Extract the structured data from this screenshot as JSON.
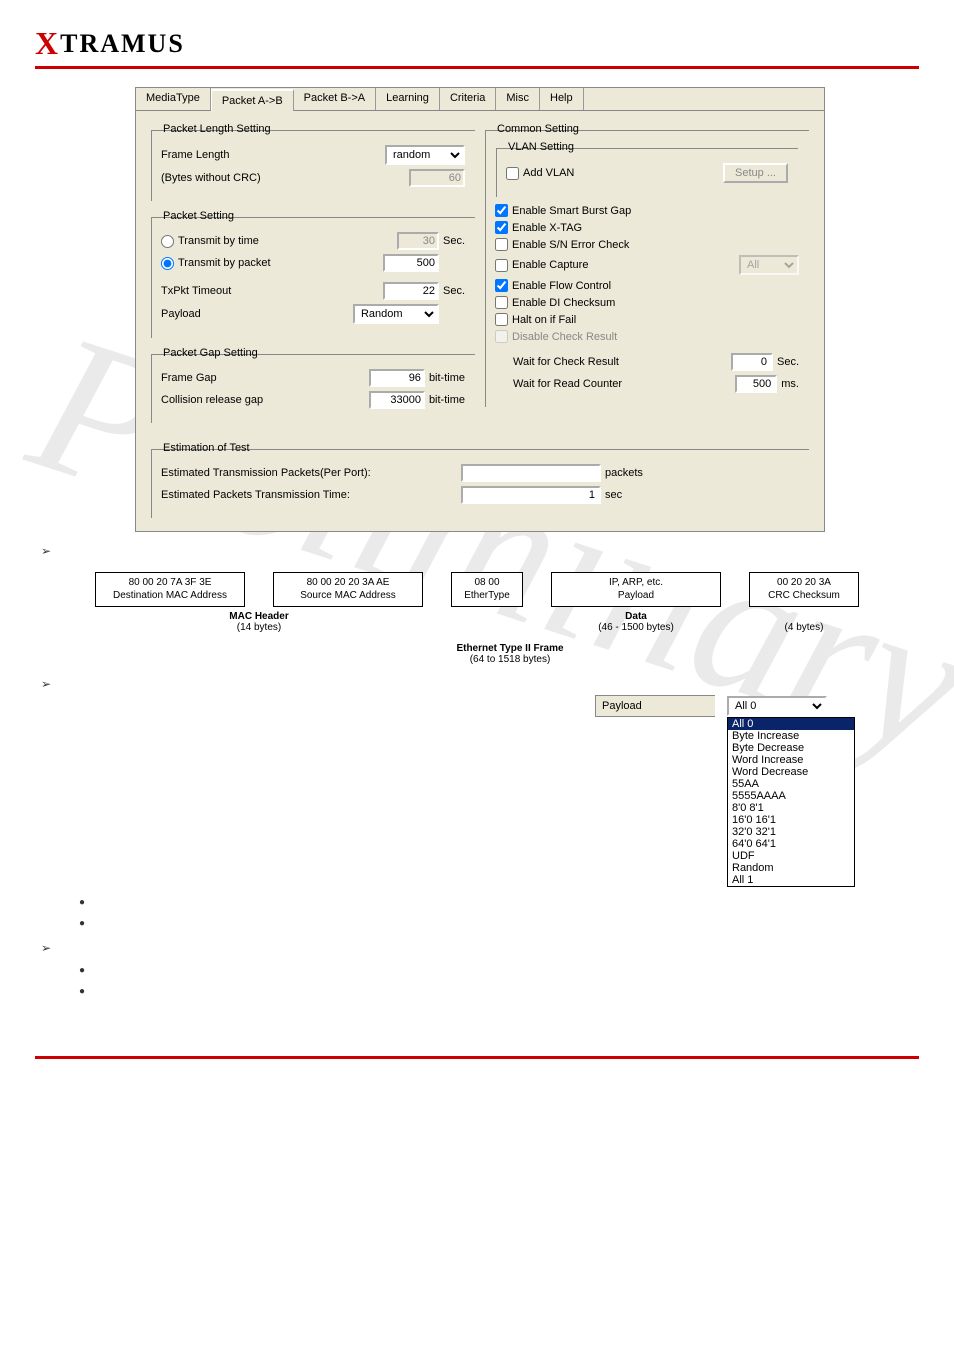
{
  "logo": {
    "x": "X",
    "rest": "TRAMUS"
  },
  "tabs": [
    "MediaType",
    "Packet A->B",
    "Packet B->A",
    "Learning",
    "Criteria",
    "Misc",
    "Help"
  ],
  "active_tab": 1,
  "packet_length": {
    "legend": "Packet Length Setting",
    "frame_length_label": "Frame Length",
    "frame_length_value": "random",
    "bytes_label": "(Bytes without CRC)",
    "bytes_value": "60"
  },
  "packet_setting": {
    "legend": "Packet Setting",
    "by_time_label": "Transmit by time",
    "by_time_value": "30",
    "by_time_unit": "Sec.",
    "by_packet_label": "Transmit by packet",
    "by_packet_value": "500",
    "timeout_label": "TxPkt Timeout",
    "timeout_value": "22",
    "timeout_unit": "Sec.",
    "payload_label": "Payload",
    "payload_value": "Random"
  },
  "packet_gap": {
    "legend": "Packet Gap Setting",
    "frame_gap_label": "Frame Gap",
    "frame_gap_value": "96",
    "frame_gap_unit": "bit-time",
    "collision_label": "Collision release gap",
    "collision_value": "33000",
    "collision_unit": "bit-time"
  },
  "estimation": {
    "legend": "Estimation of Test",
    "tx_label": "Estimated Transmission Packets(Per Port):",
    "tx_value": "",
    "tx_unit": "packets",
    "time_label": "Estimated Packets Transmission Time:",
    "time_value": "1",
    "time_unit": "sec"
  },
  "common": {
    "legend": "Common Setting",
    "vlan_legend": "VLAN Setting",
    "add_vlan_label": "Add VLAN",
    "setup_btn": "Setup ...",
    "smart_burst": "Enable Smart Burst Gap",
    "xtag": "Enable X-TAG",
    "sn_err": "Enable S/N Error Check",
    "capture": "Enable Capture",
    "capture_sel": "All",
    "flowctl": "Enable Flow Control",
    "di_chk": "Enable DI Checksum",
    "halt": "Halt on if Fail",
    "disable_chk": "Disable Check Result",
    "wait_check_label": "Wait for Check Result",
    "wait_check_value": "0",
    "wait_check_unit": "Sec.",
    "wait_read_label": "Wait for Read Counter",
    "wait_read_value": "500",
    "wait_read_unit": "ms."
  },
  "frame_diagram": {
    "dest_hex": "80  00  20  7A  3F  3E",
    "dest_sub": "Destination MAC Address",
    "src_hex": "80  00  20  20  3A  AE",
    "src_sub": "Source MAC Address",
    "etype_hex": "08  00",
    "etype_sub": "EtherType",
    "payload_top": "IP, ARP, etc.",
    "payload_sub": "Payload",
    "crc_hex": "00  20  20  3A",
    "crc_sub": "CRC Checksum",
    "mac_header": "MAC Header",
    "mac_bytes": "(14 bytes)",
    "data_header": "Data",
    "data_bytes": "(46 - 1500 bytes)",
    "crc_bytes": "(4 bytes)",
    "title": "Ethernet Type II Frame",
    "title_sub": "(64 to 1518 bytes)"
  },
  "payload_dropdown": {
    "label": "Payload",
    "selected": "All 0",
    "options": [
      "All 0",
      "Byte Increase",
      "Byte Decrease",
      "Word Increase",
      "Word Decrease",
      "55AA",
      "5555AAAA",
      "8'0 8'1",
      "16'0 16'1",
      "32'0 32'1",
      "64'0 64'1",
      "UDF",
      "Random",
      "All 1"
    ]
  },
  "watermark": "Preliminary"
}
